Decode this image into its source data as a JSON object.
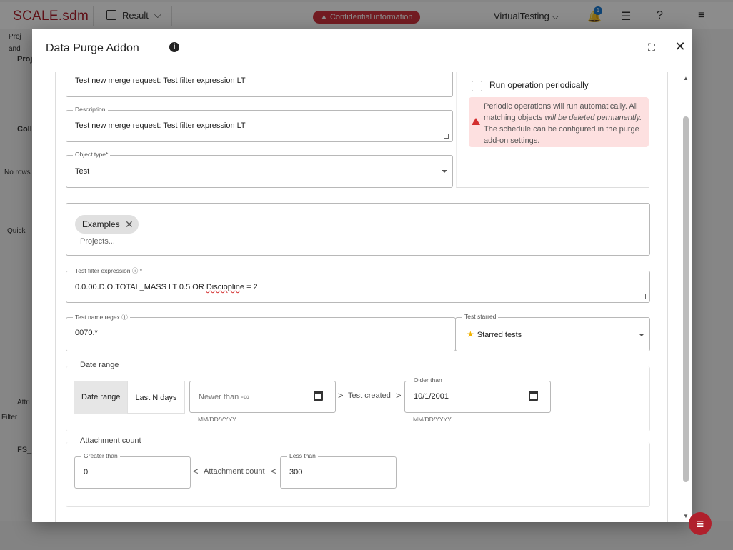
{
  "app": {
    "brand": "SCALE.sdm",
    "result_menu": "Result",
    "confidential": "Confidential information",
    "tenant": "VirtualTesting",
    "notification_count": "1",
    "bg_left_text": [
      "Proj",
      "and",
      "Colle",
      "Proj",
      "Coll",
      "No rows",
      "Quick",
      "Attri",
      "Filter",
      "FS_F"
    ]
  },
  "modal": {
    "title": "Data Purge Addon",
    "info_icon": "info-icon",
    "expand_icon": "fullscreen-icon",
    "close_label": "✕"
  },
  "form": {
    "name_value": "Test new merge request: Test filter expression LT",
    "description_label": "Description",
    "description_value": "Test new merge request: Test filter expression LT",
    "object_type_label": "Object type*",
    "object_type_value": "Test",
    "run_periodically_label": "Run operation periodically",
    "warning_part1": "Periodic operations will run automatically. All matching objects ",
    "warning_emph": "will be deleted permanently.",
    "warning_part2": " The schedule can be configured in the purge add-on settings.",
    "project_chip": "Examples",
    "projects_placeholder": "Projects...",
    "filter_label": "Test filter expression",
    "filter_required": "*",
    "filter_value_a": "0.0.00.D.O.TOTAL_MASS LT 0.5 OR ",
    "filter_value_b": "Discioplin",
    "filter_value_c": "e = 2",
    "regex_label": "Test name regex",
    "regex_value": "0070.*",
    "starred_label": "Test starred",
    "starred_value": "Starred tests",
    "date_range_title": "Date range",
    "toggle_date_range": "Date range",
    "toggle_last_n": "Last N days",
    "newer_placeholder": "Newer than -∞",
    "newer_hint": "MM/DD/YYYY",
    "gt_symbol": ">",
    "test_created": "Test created",
    "older_label": "Older than",
    "older_value": "10/1/2001",
    "older_hint": "MM/DD/YYYY",
    "attachment_title": "Attachment count",
    "greater_label": "Greater than",
    "greater_value": "0",
    "lt_symbol": "<",
    "attachment_count": "Attachment count",
    "less_label": "Less than",
    "less_value": "300"
  }
}
